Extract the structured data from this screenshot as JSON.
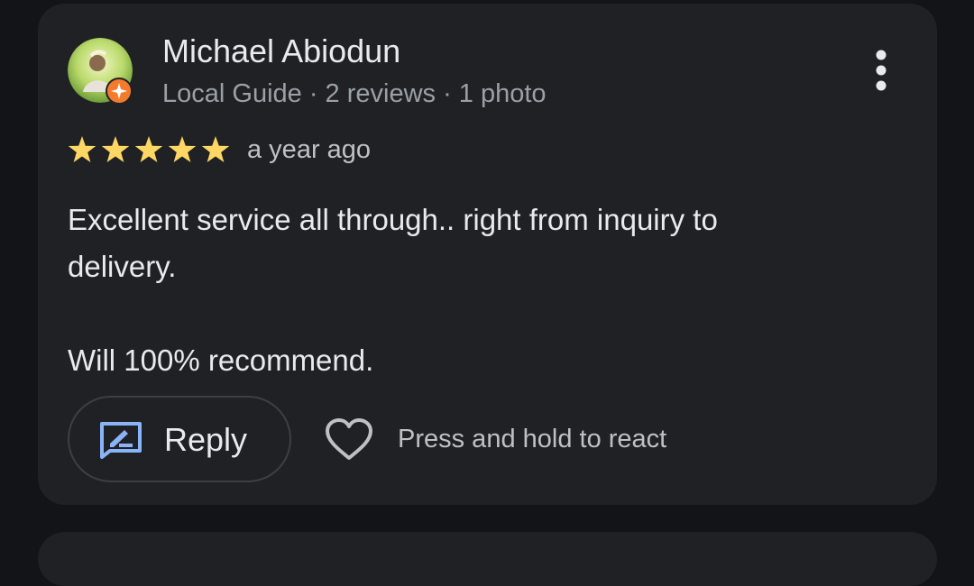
{
  "review": {
    "author_name": "Michael Abiodun",
    "author_meta": "Local Guide · 2 reviews · 1 photo",
    "rating": 5,
    "rating_max": 5,
    "date": "a year ago",
    "text": "Excellent service all through.. right from inquiry to\ndelivery.\n\nWill 100% recommend.",
    "reply_label": "Reply",
    "react_hint": "Press and hold to react"
  },
  "icons": {
    "more": "more-vert-icon",
    "reply": "rate-review-icon",
    "react": "heart-outline-icon",
    "badge": "local-guide-badge-icon",
    "star": "star-icon"
  },
  "colors": {
    "background": "#131418",
    "card": "#202124",
    "star": "#fdd663",
    "reply_icon": "#8ab4f8",
    "badge": "#f47b2c",
    "primary_text": "#e8eaed",
    "secondary_text": "#9aa0a6"
  }
}
